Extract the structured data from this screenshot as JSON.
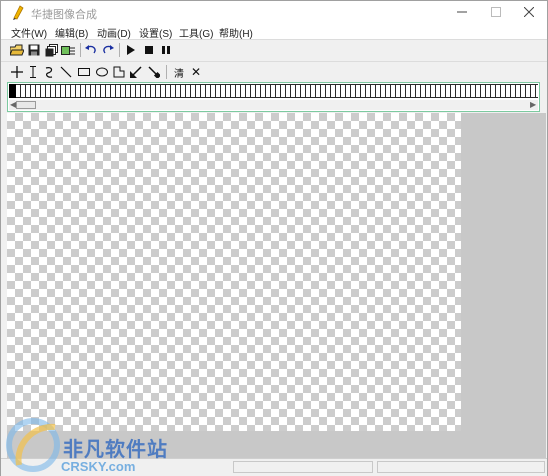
{
  "window": {
    "title": "华捷图像合成"
  },
  "menu": [
    "文件(W)",
    "编辑(B)",
    "动画(D)",
    "设置(S)",
    "工具(G)",
    "帮助(H)"
  ],
  "toolbar1": [
    {
      "name": "open-folder-icon"
    },
    {
      "name": "save-icon"
    },
    {
      "name": "copy-pages-icon"
    },
    {
      "name": "import-image-icon"
    },
    {
      "name": "undo-icon"
    },
    {
      "name": "redo-icon"
    },
    {
      "name": "play-icon"
    },
    {
      "name": "stop-icon"
    },
    {
      "name": "pause-icon"
    }
  ],
  "toolbar2": {
    "tools": [
      "crosshair-tool-icon",
      "text-cursor-tool-icon",
      "curve-tool-icon",
      "line-tool-icon",
      "rectangle-tool-icon",
      "ellipse-tool-icon",
      "polygon-tool-icon",
      "arrow-tool-icon",
      "eyedropper-tool-icon"
    ],
    "clear_label": "清",
    "close_label": "✕"
  },
  "watermark": {
    "brand": "非凡软件站",
    "site": "CRSKY.com"
  },
  "colors": {
    "timeline_border": "#7ccaa0",
    "accent": "#3b6fc0"
  }
}
